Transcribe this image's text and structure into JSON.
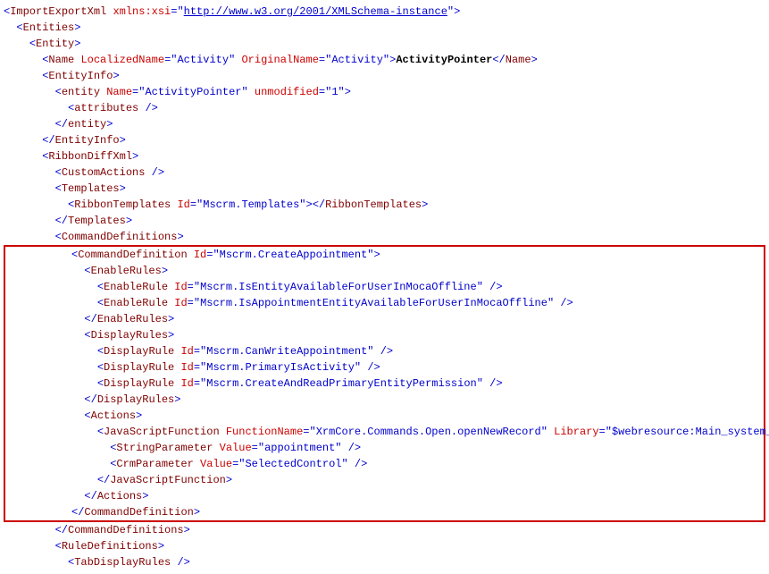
{
  "xml": {
    "l1": {
      "tag": "ImportExportXml",
      "attr": "xmlns:xsi",
      "val": "http://www.w3.org/2001/XMLSchema-instance"
    },
    "l2": {
      "tag": "Entities"
    },
    "l3": {
      "tag": "Entity"
    },
    "l4": {
      "tag": "Name",
      "a1": "LocalizedName",
      "v1": "Activity",
      "a2": "OriginalName",
      "v2": "Activity",
      "text": "ActivityPointer"
    },
    "l5": {
      "tag": "EntityInfo"
    },
    "l6": {
      "tag": "entity",
      "a1": "Name",
      "v1": "ActivityPointer",
      "a2": "unmodified",
      "v2": "1"
    },
    "l7": {
      "tag": "attributes"
    },
    "l8": {
      "tag": "entity"
    },
    "l9": {
      "tag": "EntityInfo"
    },
    "l10": {
      "tag": "RibbonDiffXml"
    },
    "l11": {
      "tag": "CustomActions"
    },
    "l12": {
      "tag": "Templates"
    },
    "l13": {
      "tag": "RibbonTemplates",
      "a1": "Id",
      "v1": "Mscrm.Templates"
    },
    "l14": {
      "tag": "Templates"
    },
    "l15": {
      "tag": "CommandDefinitions"
    },
    "l16": {
      "tag": "CommandDefinition",
      "a1": "Id",
      "v1": "Mscrm.CreateAppointment"
    },
    "l17": {
      "tag": "EnableRules"
    },
    "l18": {
      "tag": "EnableRule",
      "a1": "Id",
      "v1": "Mscrm.IsEntityAvailableForUserInMocaOffline"
    },
    "l19": {
      "tag": "EnableRule",
      "a1": "Id",
      "v1": "Mscrm.IsAppointmentEntityAvailableForUserInMocaOffline"
    },
    "l20": {
      "tag": "EnableRules"
    },
    "l21": {
      "tag": "DisplayRules"
    },
    "l22": {
      "tag": "DisplayRule",
      "a1": "Id",
      "v1": "Mscrm.CanWriteAppointment"
    },
    "l23": {
      "tag": "DisplayRule",
      "a1": "Id",
      "v1": "Mscrm.PrimaryIsActivity"
    },
    "l24": {
      "tag": "DisplayRule",
      "a1": "Id",
      "v1": "Mscrm.CreateAndReadPrimaryEntityPermission"
    },
    "l25": {
      "tag": "DisplayRules"
    },
    "l26": {
      "tag": "Actions"
    },
    "l27": {
      "tag": "JavaScriptFunction",
      "a1": "FunctionName",
      "v1": "XrmCore.Commands.Open.openNewRecord",
      "a2": "Library",
      "v2": "$webresource:Main_system_library.js"
    },
    "l28": {
      "tag": "StringParameter",
      "a1": "Value",
      "v1": "appointment"
    },
    "l29": {
      "tag": "CrmParameter",
      "a1": "Value",
      "v1": "SelectedControl"
    },
    "l30": {
      "tag": "JavaScriptFunction"
    },
    "l31": {
      "tag": "Actions"
    },
    "l32": {
      "tag": "CommandDefinition"
    },
    "l33": {
      "tag": "CommandDefinitions"
    },
    "l34": {
      "tag": "RuleDefinitions"
    },
    "l35": {
      "tag": "TabDisplayRules"
    }
  }
}
